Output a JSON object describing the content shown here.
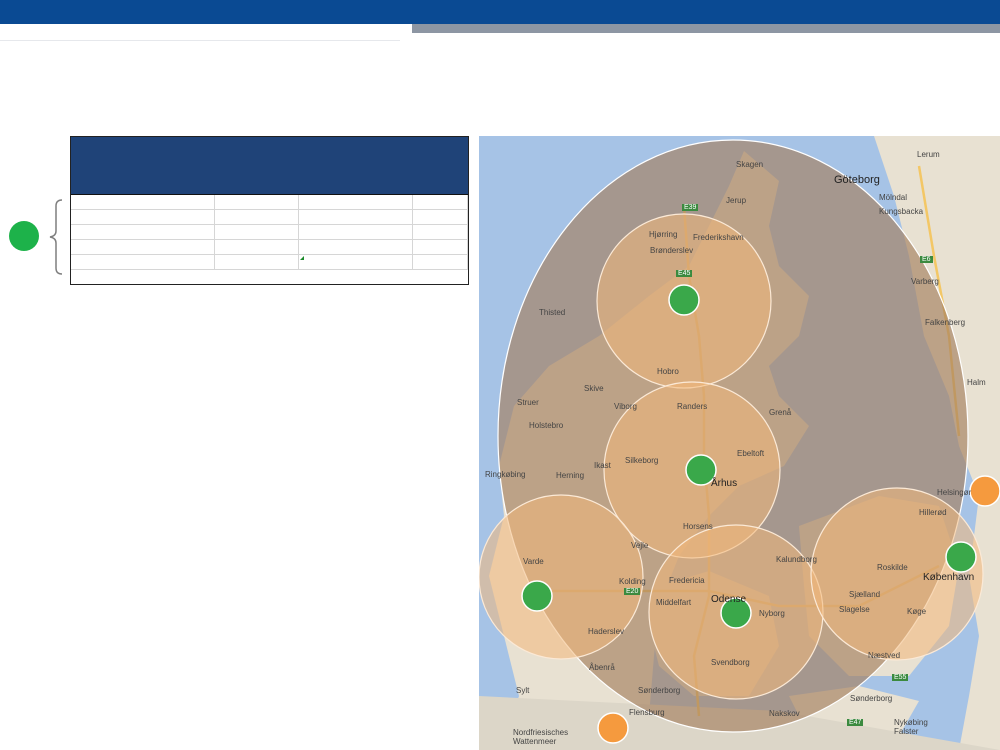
{
  "header": {
    "bar_color": "#0a4a93",
    "accent_color": "#8d96a3"
  },
  "table": {
    "header_color": "#1f4378",
    "rows": [
      [
        "",
        "",
        "",
        ""
      ],
      [
        "",
        "",
        "",
        ""
      ],
      [
        "",
        "",
        "",
        ""
      ],
      [
        "",
        "",
        "",
        ""
      ],
      [
        "",
        "",
        "",
        ""
      ]
    ]
  },
  "legend": {
    "marker_color": "#1db24a"
  },
  "map": {
    "water_color": "#a6c3e6",
    "land_color": "#e8e1d2",
    "coverage_large_color": "#a47f5f",
    "coverage_circle_color": "#f2b87a",
    "site_green_color": "#3aa84a",
    "site_orange_color": "#f59a3e",
    "labels": {
      "skagen": "Skagen",
      "goteborg": "Göteborg",
      "lerum": "Lerum",
      "molndal": "Mölndal",
      "kungsbacka": "Kungsbacka",
      "jerup": "Jerup",
      "hjorring": "Hjørring",
      "frederikshavn": "Frederikshavn",
      "bronderslev": "Brønderslev",
      "thisted": "Thisted",
      "varberg": "Varberg",
      "falkenberg": "Falkenberg",
      "halmstad": "Halm",
      "hobro": "Hobro",
      "skive": "Skive",
      "struer": "Struer",
      "viborg": "Viborg",
      "randers": "Randers",
      "grena": "Grenå",
      "holstebro": "Holstebro",
      "silkeborg": "Silkeborg",
      "ebeltoft": "Ebeltoft",
      "aarhus": "Århus",
      "herning": "Herning",
      "ikast": "Ikast",
      "ringkobing": "Ringkøbing",
      "horsens": "Horsens",
      "helsingor": "Helsingør",
      "hillerod": "Hillerød",
      "vejle": "Vejle",
      "kalundborg": "Kalundborg",
      "varde": "Varde",
      "kolding": "Kolding",
      "fredericia": "Fredericia",
      "middelfart": "Middelfart",
      "odense": "Odense",
      "nyborg": "Nyborg",
      "roskilde": "Roskilde",
      "kobenhavn": "København",
      "sjaelland": "Sjælland",
      "slagelse": "Slagelse",
      "koge": "Køge",
      "haderslev": "Haderslev",
      "svendborg": "Svendborg",
      "naestved": "Næstved",
      "aabenraa": "Åbenrå",
      "sonderborg": "Sønderborg",
      "flensburg": "Flensburg",
      "nakskov": "Nakskov",
      "nykobing": "Nykøbing\nFalster",
      "sylt": "Sylt",
      "nordfriesisches": "Nordfriesisches\nWattenmeer",
      "e39": "E39",
      "e45": "E45",
      "e6": "E6",
      "e20": "E20",
      "e47": "E47",
      "e55": "E55"
    }
  }
}
